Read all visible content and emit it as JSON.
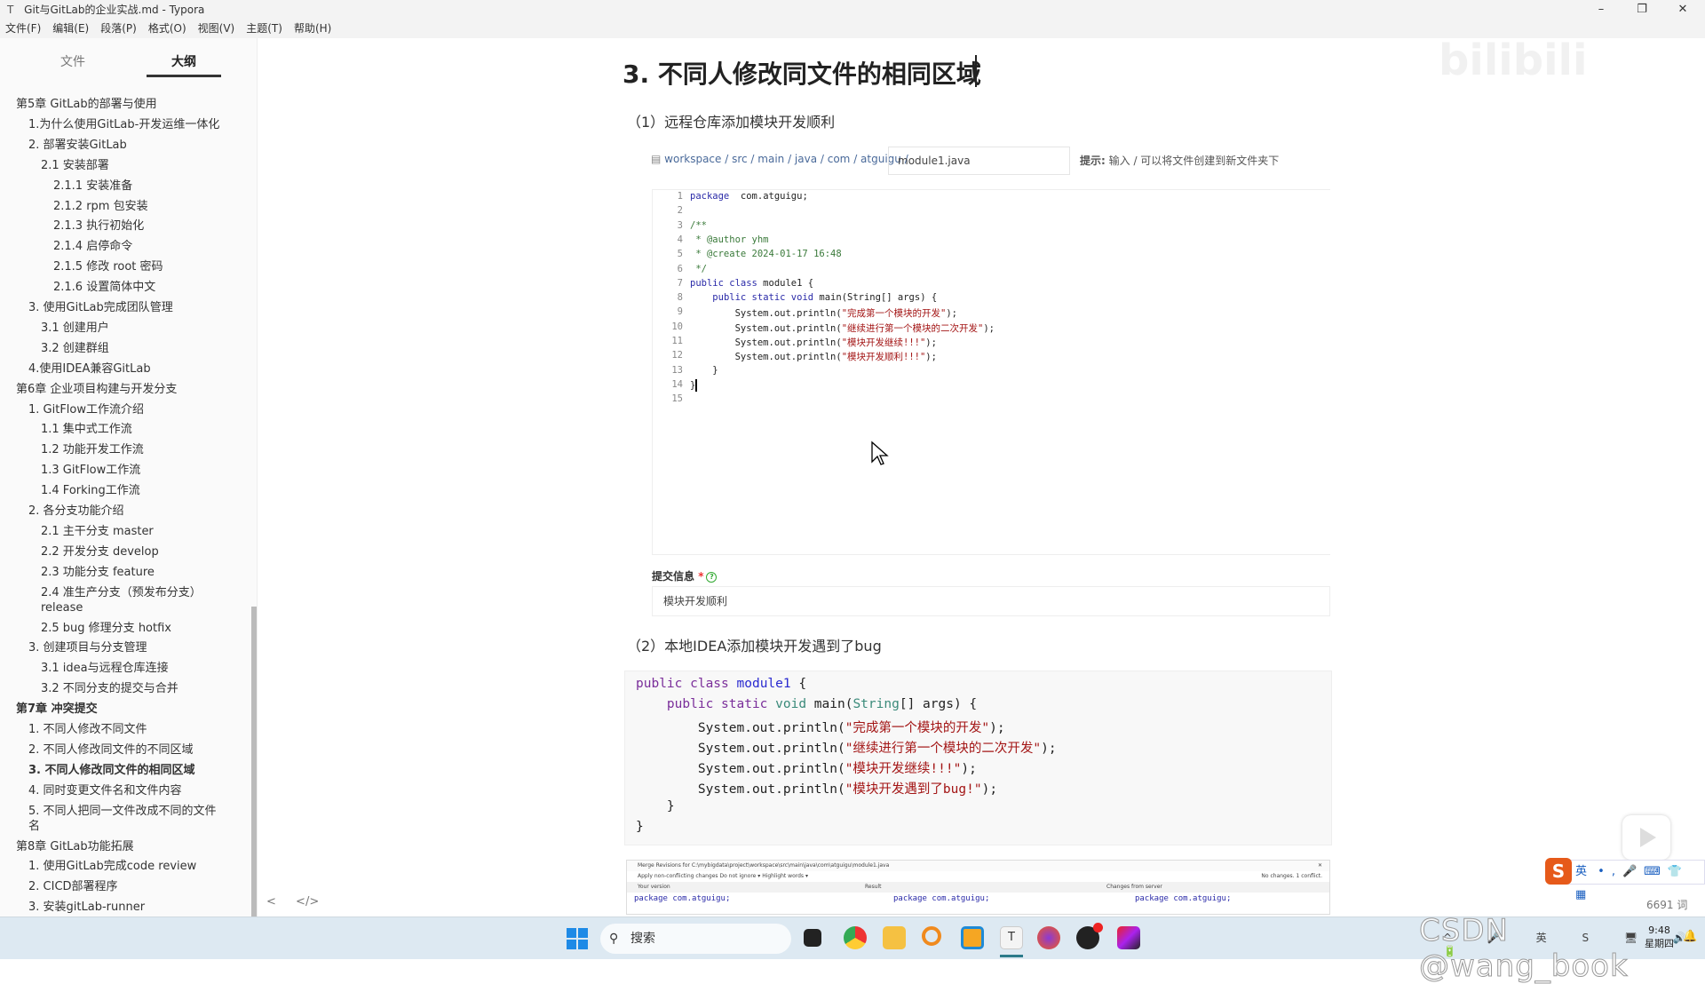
{
  "window": {
    "title": "Git与GitLab的企业实战.md - Typora",
    "app_icon": "T"
  },
  "menu": [
    "文件(F)",
    "编辑(E)",
    "段落(P)",
    "格式(O)",
    "视图(V)",
    "主题(T)",
    "帮助(H)"
  ],
  "sidebar": {
    "tabs": [
      "文件",
      "大纲"
    ],
    "active_tab": "大纲",
    "outline": [
      {
        "t": "第5章 GitLab的部署与使用",
        "l": 0
      },
      {
        "t": "1.为什么使用GitLab-开发运维一体化",
        "l": 1
      },
      {
        "t": "2. 部署安装GitLab",
        "l": 1
      },
      {
        "t": "2.1 安装部署",
        "l": 2
      },
      {
        "t": "2.1.1 安装准备",
        "l": 3
      },
      {
        "t": "2.1.2 rpm 包安装",
        "l": 3
      },
      {
        "t": "2.1.3 执行初始化",
        "l": 3
      },
      {
        "t": "2.1.4 启停命令",
        "l": 3
      },
      {
        "t": "2.1.5 修改 root 密码",
        "l": 3
      },
      {
        "t": "2.1.6 设置简体中文",
        "l": 3
      },
      {
        "t": "3. 使用GitLab完成团队管理",
        "l": 1
      },
      {
        "t": "3.1 创建用户",
        "l": 2
      },
      {
        "t": "3.2 创建群组",
        "l": 2
      },
      {
        "t": "4.使用IDEA兼容GitLab",
        "l": 1
      },
      {
        "t": "第6章 企业项目构建与开发分支",
        "l": 0
      },
      {
        "t": "1. GitFlow工作流介绍",
        "l": 1
      },
      {
        "t": "1.1 集中式工作流",
        "l": 2
      },
      {
        "t": "1.2 功能开发工作流",
        "l": 2
      },
      {
        "t": "1.3 GitFlow工作流",
        "l": 2
      },
      {
        "t": "1.4 Forking工作流",
        "l": 2
      },
      {
        "t": "2. 各分支功能介绍",
        "l": 1
      },
      {
        "t": "2.1 主干分支 master",
        "l": 2
      },
      {
        "t": "2.2 开发分支 develop",
        "l": 2
      },
      {
        "t": "2.3 功能分支 feature",
        "l": 2
      },
      {
        "t": "2.4 准生产分支（预发布分支）",
        "t2": "release",
        "l": 2
      },
      {
        "t": "2.5 bug 修理分支 hotfix",
        "l": 2
      },
      {
        "t": "3. 创建项目与分支管理",
        "l": 1
      },
      {
        "t": "3.1 idea与远程仓库连接",
        "l": 2
      },
      {
        "t": "3.2 不同分支的提交与合并",
        "l": 2
      },
      {
        "t": "第7章 冲突提交",
        "l": 0,
        "bold": true
      },
      {
        "t": "1. 不同人修改不同文件",
        "l": 1
      },
      {
        "t": "2. 不同人修改同文件的不同区域",
        "l": 1
      },
      {
        "t": "3. 不同人修改同文件的相同区域",
        "l": 1,
        "bold": true,
        "active": true
      },
      {
        "t": "4. 同时变更文件名和文件内容",
        "l": 1
      },
      {
        "t": "5. 不同人把同一文件改成不同的文件",
        "t2": "名",
        "l": 1
      },
      {
        "t": "第8章 GitLab功能拓展",
        "l": 0
      },
      {
        "t": "1. 使用GitLab完成code review",
        "l": 1
      },
      {
        "t": "2. CICD部署程序",
        "l": 1
      },
      {
        "t": "3. 安装gitLab-runner",
        "l": 1
      }
    ]
  },
  "doc": {
    "heading": "3. 不同人修改同文件的相同区域",
    "sub1": "（1）远程仓库添加模块开发顺利",
    "breadcrumb": "workspace / src / main / java / com / atguigu /",
    "filename": "module1.java",
    "hint_label": "提示:",
    "hint": " 输入 / 可以将文件创建到新文件夹下",
    "editor_lines": [
      [
        [
          "kw",
          "package"
        ],
        [
          "",
          "  com.atguigu;"
        ]
      ],
      [],
      [
        [
          "cm",
          "/**"
        ]
      ],
      [
        [
          "cm",
          " * @author yhm"
        ]
      ],
      [
        [
          "cm",
          " * @create 2024-01-17 16:48"
        ]
      ],
      [
        [
          "cm",
          " */"
        ]
      ],
      [
        [
          "kw",
          "public class"
        ],
        [
          "",
          " module1 {"
        ]
      ],
      [
        [
          "",
          "    "
        ],
        [
          "kw",
          "public static void"
        ],
        [
          "",
          " main(String[] args) {"
        ]
      ],
      [
        [
          "",
          "        System.out.println("
        ],
        [
          "st",
          "\"完成第一个模块的开发\""
        ],
        [
          "",
          ");"
        ]
      ],
      [
        [
          "",
          "        System.out.println("
        ],
        [
          "st",
          "\"继续进行第一个模块的二次开发\""
        ],
        [
          "",
          ");"
        ]
      ],
      [
        [
          "",
          "        System.out.println("
        ],
        [
          "st",
          "\"模块开发继续!!!\""
        ],
        [
          "",
          ");"
        ]
      ],
      [
        [
          "",
          "        System.out.println("
        ],
        [
          "st",
          "\"模块开发顺利!!!\""
        ],
        [
          "",
          ");"
        ]
      ],
      [
        [
          "",
          "    }"
        ]
      ],
      [
        [
          "",
          "}"
        ],
        [
          "cursor",
          ""
        ]
      ],
      []
    ],
    "commit_label": "提交信息",
    "commit_required": "*",
    "commit_help": "?",
    "commit_value": "模块开发顺利",
    "sub2": "（2）本地IDEA添加模块开发遇到了bug",
    "code_block": [
      [
        [
          "kw",
          "public class "
        ],
        [
          "cls",
          "module1"
        ],
        [
          "",
          " {"
        ]
      ],
      [
        [
          "",
          "    "
        ],
        [
          "kw",
          "public static "
        ],
        [
          "ty",
          "void"
        ],
        [
          "",
          " main("
        ],
        [
          "ty",
          "String"
        ],
        [
          "",
          "[] args) {"
        ]
      ],
      [
        [
          "",
          "        System.out.println("
        ],
        [
          "st",
          "\"完成第一个模块的开发\""
        ],
        [
          "",
          ");"
        ]
      ],
      [
        [
          "",
          "        System.out.println("
        ],
        [
          "st",
          "\"继续进行第一个模块的二次开发\""
        ],
        [
          "",
          ");"
        ]
      ],
      [
        [
          "",
          "        System.out.println("
        ],
        [
          "st",
          "\"模块开发继续!!!\""
        ],
        [
          "",
          ");"
        ]
      ],
      [
        [
          "",
          "        System.out.println("
        ],
        [
          "st",
          "\"模块开发遇到了bug!\""
        ],
        [
          "",
          ");"
        ]
      ],
      [
        [
          "",
          "    }"
        ]
      ],
      [
        [
          "",
          "}"
        ]
      ]
    ],
    "merge_image": {
      "title": "Merge Revisions for C:\\mybigdata\\project\\workspace\\src\\main\\java\\com\\atguigu\\module1.java",
      "toolbar": "Apply non-conflicting changes   Do not ignore ▾   Highlight words ▾",
      "status": "No changes. 1 conflict.",
      "your_version": "Your version",
      "result": "Result",
      "server": "Changes from server",
      "code": "package com.atguigu;"
    }
  },
  "status": {
    "word_count": "6691 词",
    "back": "<",
    "source": "</>"
  },
  "taskbar": {
    "search": "搜索",
    "clock_time": "9:48",
    "clock_day": "星期四",
    "ime_lang": "英",
    "tray_lang": "英"
  },
  "watermark": "CSDN @wang_book",
  "overlay_logo": "bilibili",
  "colors": {
    "keyword": "#2a2aa8",
    "string": "#a31515",
    "comment": "#3a7a3a",
    "taskbar": "#dde9f2"
  }
}
